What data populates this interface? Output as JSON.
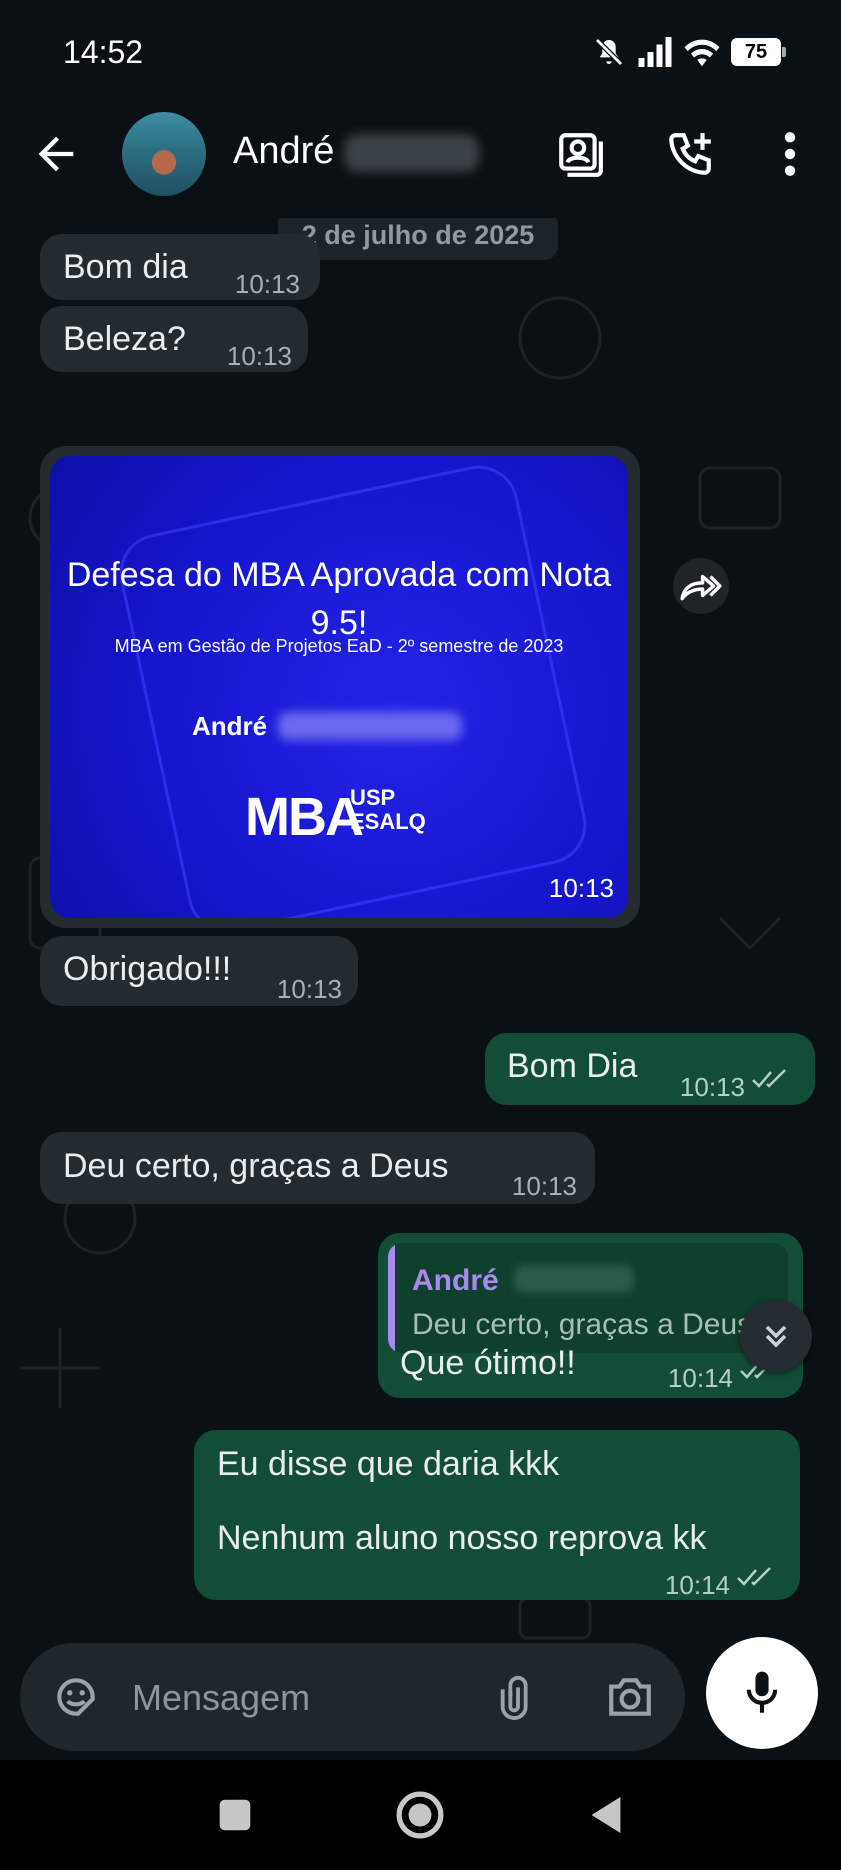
{
  "status_bar": {
    "time": "14:52",
    "battery": "75",
    "icons": [
      "mute-icon",
      "signal-icon",
      "wifi-icon",
      "battery-icon"
    ]
  },
  "header": {
    "contact_name": "André",
    "icons": [
      "back-arrow-icon",
      "avatar",
      "contact-card-icon",
      "add-call-icon",
      "more-vert-icon"
    ]
  },
  "chat": {
    "date_divider": "2 de julho de 2025",
    "messages": [
      {
        "dir": "in",
        "text": "Bom dia",
        "time": "10:13"
      },
      {
        "dir": "in",
        "text": "Beleza?",
        "time": "10:13"
      },
      {
        "dir": "in",
        "type": "image",
        "time": "10:13",
        "image": {
          "title": "Defesa do MBA Aprovada com Nota 9.5!",
          "subtitle": "MBA em Gestão de Projetos EaD - 2º semestre de 2023",
          "name": "André",
          "logo_main": "MBA",
          "logo_top": "USP",
          "logo_bottom": "ESALQ"
        }
      },
      {
        "dir": "in",
        "text": "Obrigado!!!",
        "time": "10:13"
      },
      {
        "dir": "out",
        "text": "Bom Dia",
        "time": "10:13",
        "status": "read"
      },
      {
        "dir": "in",
        "text": "Deu certo, graças a Deus",
        "time": "10:13"
      },
      {
        "dir": "out",
        "text": "Que ótimo!!",
        "time": "10:14",
        "status": "read",
        "reply_to": {
          "name": "André",
          "text": "Deu certo, graças a Deus"
        }
      },
      {
        "dir": "out",
        "line1": "Eu disse que daria kkk",
        "line2": "Nenhum aluno nosso reprova kk",
        "time": "10:14",
        "status": "read"
      }
    ]
  },
  "composer": {
    "placeholder": "Mensagem"
  },
  "colors": {
    "incoming": "#242b30",
    "outgoing": "#134d37",
    "background": "#0b1014",
    "reply_accent": "#a98bef",
    "tick": "#b4d0c3"
  }
}
